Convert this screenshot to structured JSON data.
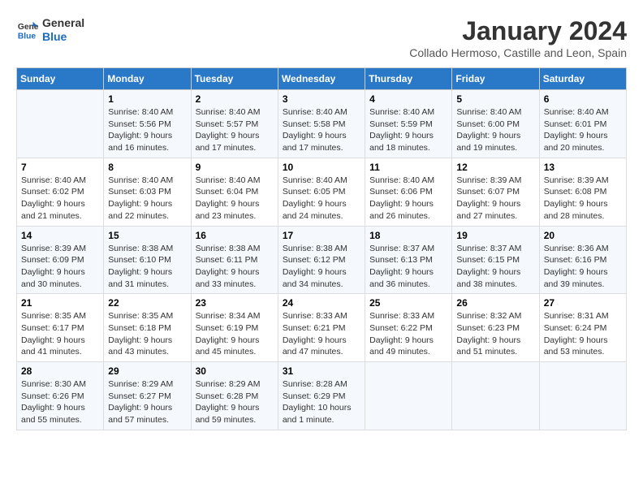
{
  "logo": {
    "line1": "General",
    "line2": "Blue"
  },
  "title": "January 2024",
  "subtitle": "Collado Hermoso, Castille and Leon, Spain",
  "columns": [
    "Sunday",
    "Monday",
    "Tuesday",
    "Wednesday",
    "Thursday",
    "Friday",
    "Saturday"
  ],
  "weeks": [
    [
      {
        "day": "",
        "detail": ""
      },
      {
        "day": "1",
        "detail": "Sunrise: 8:40 AM\nSunset: 5:56 PM\nDaylight: 9 hours\nand 16 minutes."
      },
      {
        "day": "2",
        "detail": "Sunrise: 8:40 AM\nSunset: 5:57 PM\nDaylight: 9 hours\nand 17 minutes."
      },
      {
        "day": "3",
        "detail": "Sunrise: 8:40 AM\nSunset: 5:58 PM\nDaylight: 9 hours\nand 17 minutes."
      },
      {
        "day": "4",
        "detail": "Sunrise: 8:40 AM\nSunset: 5:59 PM\nDaylight: 9 hours\nand 18 minutes."
      },
      {
        "day": "5",
        "detail": "Sunrise: 8:40 AM\nSunset: 6:00 PM\nDaylight: 9 hours\nand 19 minutes."
      },
      {
        "day": "6",
        "detail": "Sunrise: 8:40 AM\nSunset: 6:01 PM\nDaylight: 9 hours\nand 20 minutes."
      }
    ],
    [
      {
        "day": "7",
        "detail": "Sunrise: 8:40 AM\nSunset: 6:02 PM\nDaylight: 9 hours\nand 21 minutes."
      },
      {
        "day": "8",
        "detail": "Sunrise: 8:40 AM\nSunset: 6:03 PM\nDaylight: 9 hours\nand 22 minutes."
      },
      {
        "day": "9",
        "detail": "Sunrise: 8:40 AM\nSunset: 6:04 PM\nDaylight: 9 hours\nand 23 minutes."
      },
      {
        "day": "10",
        "detail": "Sunrise: 8:40 AM\nSunset: 6:05 PM\nDaylight: 9 hours\nand 24 minutes."
      },
      {
        "day": "11",
        "detail": "Sunrise: 8:40 AM\nSunset: 6:06 PM\nDaylight: 9 hours\nand 26 minutes."
      },
      {
        "day": "12",
        "detail": "Sunrise: 8:39 AM\nSunset: 6:07 PM\nDaylight: 9 hours\nand 27 minutes."
      },
      {
        "day": "13",
        "detail": "Sunrise: 8:39 AM\nSunset: 6:08 PM\nDaylight: 9 hours\nand 28 minutes."
      }
    ],
    [
      {
        "day": "14",
        "detail": "Sunrise: 8:39 AM\nSunset: 6:09 PM\nDaylight: 9 hours\nand 30 minutes."
      },
      {
        "day": "15",
        "detail": "Sunrise: 8:38 AM\nSunset: 6:10 PM\nDaylight: 9 hours\nand 31 minutes."
      },
      {
        "day": "16",
        "detail": "Sunrise: 8:38 AM\nSunset: 6:11 PM\nDaylight: 9 hours\nand 33 minutes."
      },
      {
        "day": "17",
        "detail": "Sunrise: 8:38 AM\nSunset: 6:12 PM\nDaylight: 9 hours\nand 34 minutes."
      },
      {
        "day": "18",
        "detail": "Sunrise: 8:37 AM\nSunset: 6:13 PM\nDaylight: 9 hours\nand 36 minutes."
      },
      {
        "day": "19",
        "detail": "Sunrise: 8:37 AM\nSunset: 6:15 PM\nDaylight: 9 hours\nand 38 minutes."
      },
      {
        "day": "20",
        "detail": "Sunrise: 8:36 AM\nSunset: 6:16 PM\nDaylight: 9 hours\nand 39 minutes."
      }
    ],
    [
      {
        "day": "21",
        "detail": "Sunrise: 8:35 AM\nSunset: 6:17 PM\nDaylight: 9 hours\nand 41 minutes."
      },
      {
        "day": "22",
        "detail": "Sunrise: 8:35 AM\nSunset: 6:18 PM\nDaylight: 9 hours\nand 43 minutes."
      },
      {
        "day": "23",
        "detail": "Sunrise: 8:34 AM\nSunset: 6:19 PM\nDaylight: 9 hours\nand 45 minutes."
      },
      {
        "day": "24",
        "detail": "Sunrise: 8:33 AM\nSunset: 6:21 PM\nDaylight: 9 hours\nand 47 minutes."
      },
      {
        "day": "25",
        "detail": "Sunrise: 8:33 AM\nSunset: 6:22 PM\nDaylight: 9 hours\nand 49 minutes."
      },
      {
        "day": "26",
        "detail": "Sunrise: 8:32 AM\nSunset: 6:23 PM\nDaylight: 9 hours\nand 51 minutes."
      },
      {
        "day": "27",
        "detail": "Sunrise: 8:31 AM\nSunset: 6:24 PM\nDaylight: 9 hours\nand 53 minutes."
      }
    ],
    [
      {
        "day": "28",
        "detail": "Sunrise: 8:30 AM\nSunset: 6:26 PM\nDaylight: 9 hours\nand 55 minutes."
      },
      {
        "day": "29",
        "detail": "Sunrise: 8:29 AM\nSunset: 6:27 PM\nDaylight: 9 hours\nand 57 minutes."
      },
      {
        "day": "30",
        "detail": "Sunrise: 8:29 AM\nSunset: 6:28 PM\nDaylight: 9 hours\nand 59 minutes."
      },
      {
        "day": "31",
        "detail": "Sunrise: 8:28 AM\nSunset: 6:29 PM\nDaylight: 10 hours\nand 1 minute."
      },
      {
        "day": "",
        "detail": ""
      },
      {
        "day": "",
        "detail": ""
      },
      {
        "day": "",
        "detail": ""
      }
    ]
  ]
}
